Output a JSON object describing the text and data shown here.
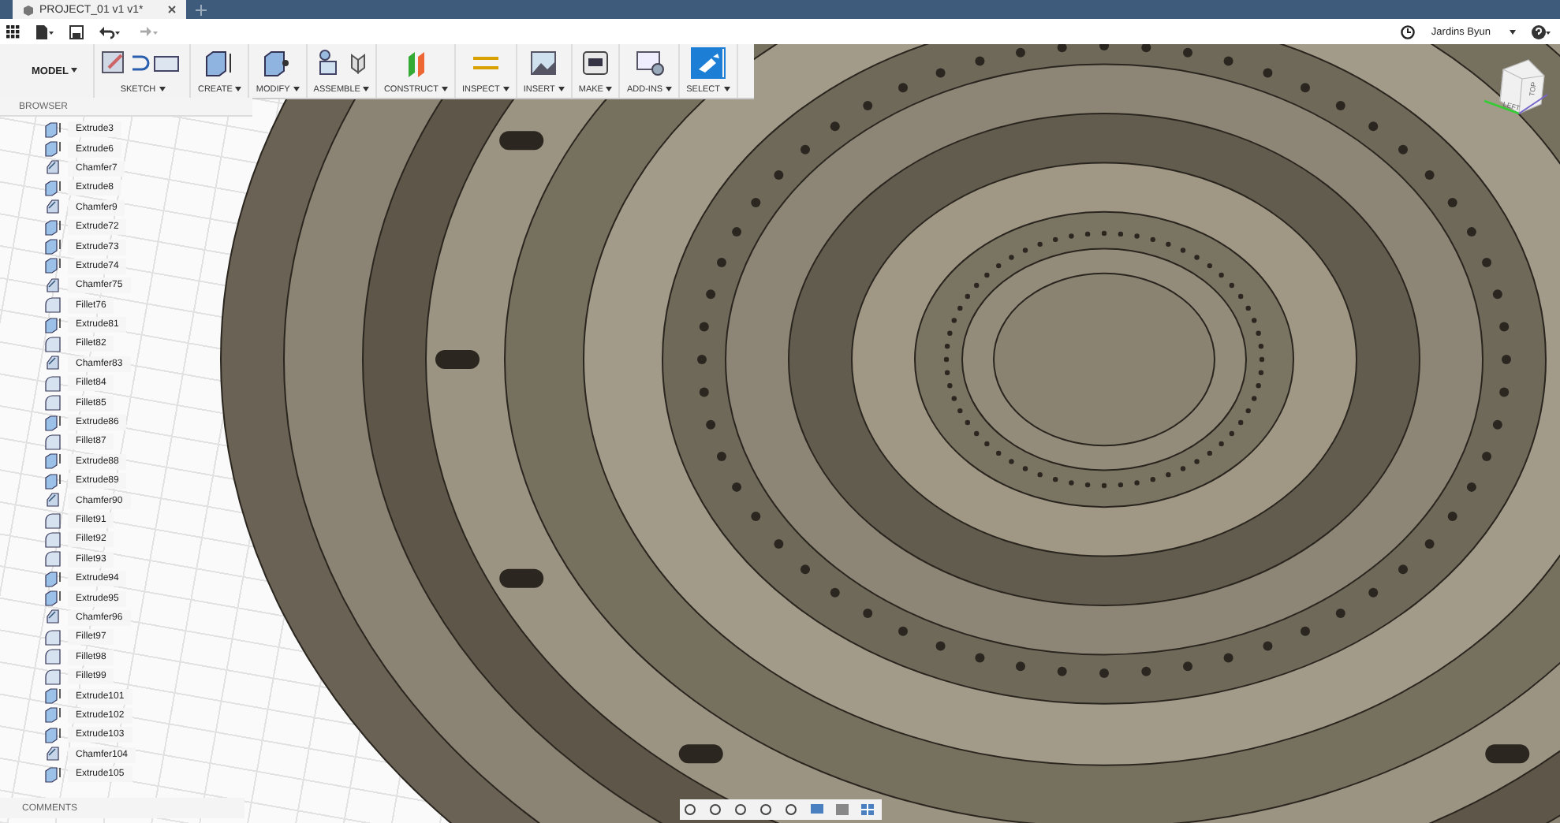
{
  "window": {
    "tab_title": "PROJECT_01 v1 v1*",
    "user": "Jardins Byun"
  },
  "workspace": {
    "label": "MODEL"
  },
  "toolbar": [
    {
      "label": "SKETCH",
      "selected": false
    },
    {
      "label": "CREATE",
      "selected": false
    },
    {
      "label": "MODIFY",
      "selected": false
    },
    {
      "label": "ASSEMBLE",
      "selected": false
    },
    {
      "label": "CONSTRUCT",
      "selected": false
    },
    {
      "label": "INSPECT",
      "selected": false
    },
    {
      "label": "INSERT",
      "selected": false
    },
    {
      "label": "MAKE",
      "selected": false
    },
    {
      "label": "ADD-INS",
      "selected": false
    },
    {
      "label": "SELECT",
      "selected": true
    }
  ],
  "browser": {
    "title": "BROWSER",
    "items": [
      {
        "label": "Extrude3",
        "kind": "extrude"
      },
      {
        "label": "Extrude6",
        "kind": "extrude"
      },
      {
        "label": "Chamfer7",
        "kind": "chamfer"
      },
      {
        "label": "Extrude8",
        "kind": "extrude"
      },
      {
        "label": "Chamfer9",
        "kind": "chamfer"
      },
      {
        "label": "Extrude72",
        "kind": "extrude"
      },
      {
        "label": "Extrude73",
        "kind": "extrude"
      },
      {
        "label": "Extrude74",
        "kind": "extrude"
      },
      {
        "label": "Chamfer75",
        "kind": "chamfer"
      },
      {
        "label": "Fillet76",
        "kind": "fillet"
      },
      {
        "label": "Extrude81",
        "kind": "extrude"
      },
      {
        "label": "Fillet82",
        "kind": "fillet"
      },
      {
        "label": "Chamfer83",
        "kind": "chamfer"
      },
      {
        "label": "Fillet84",
        "kind": "fillet"
      },
      {
        "label": "Fillet85",
        "kind": "fillet"
      },
      {
        "label": "Extrude86",
        "kind": "extrude"
      },
      {
        "label": "Fillet87",
        "kind": "fillet"
      },
      {
        "label": "Extrude88",
        "kind": "extrude"
      },
      {
        "label": "Extrude89",
        "kind": "extrude"
      },
      {
        "label": "Chamfer90",
        "kind": "chamfer"
      },
      {
        "label": "Fillet91",
        "kind": "fillet"
      },
      {
        "label": "Fillet92",
        "kind": "fillet"
      },
      {
        "label": "Fillet93",
        "kind": "fillet"
      },
      {
        "label": "Extrude94",
        "kind": "extrude"
      },
      {
        "label": "Extrude95",
        "kind": "extrude"
      },
      {
        "label": "Chamfer96",
        "kind": "chamfer"
      },
      {
        "label": "Fillet97",
        "kind": "fillet"
      },
      {
        "label": "Fillet98",
        "kind": "fillet"
      },
      {
        "label": "Fillet99",
        "kind": "fillet"
      },
      {
        "label": "Extrude101",
        "kind": "extrude"
      },
      {
        "label": "Extrude102",
        "kind": "extrude"
      },
      {
        "label": "Extrude103",
        "kind": "extrude"
      },
      {
        "label": "Chamfer104",
        "kind": "chamfer"
      },
      {
        "label": "Extrude105",
        "kind": "extrude"
      }
    ]
  },
  "comments": {
    "title": "COMMENTS"
  },
  "view_cube": {
    "faces": [
      "TOP",
      "LEFT"
    ]
  }
}
